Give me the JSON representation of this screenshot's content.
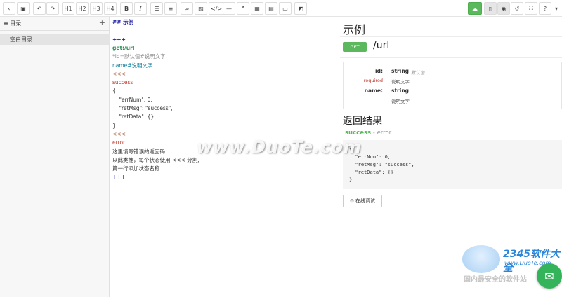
{
  "toolbar": {
    "headings": [
      "H1",
      "H2",
      "H3",
      "H4"
    ],
    "bold": "B",
    "italic": "I"
  },
  "sidebar": {
    "title": "目录",
    "add": "+",
    "empty_item": "空白目录"
  },
  "editor": {
    "lines": [
      {
        "text": "## 示例",
        "cls": "c-head"
      },
      {
        "text": "",
        "cls": "c-plain"
      },
      {
        "text": "+++",
        "cls": "c-plus"
      },
      {
        "text": "get:/url",
        "cls": "c-get"
      },
      {
        "text": "*id=默认值#说明文字",
        "cls": "c-cmt"
      },
      {
        "text": "name#说明文字",
        "cls": "c-key"
      },
      {
        "text": "<<<",
        "cls": "c-sep"
      },
      {
        "text": "success",
        "cls": "c-succ"
      },
      {
        "text": "{",
        "cls": "c-plain"
      },
      {
        "text": "    \"errNum\": 0,",
        "cls": "c-plain"
      },
      {
        "text": "    \"retMsg\": \"success\",",
        "cls": "c-plain"
      },
      {
        "text": "    \"retData\": {}",
        "cls": "c-plain"
      },
      {
        "text": "}",
        "cls": "c-plain"
      },
      {
        "text": "<<<",
        "cls": "c-sep"
      },
      {
        "text": "error",
        "cls": "c-err"
      },
      {
        "text": "这里填写错误的返回码",
        "cls": "c-plain"
      },
      {
        "text": "以此类推，每个状态使用 <<< 分割,",
        "cls": "c-plain"
      },
      {
        "text": "第一行添加状态名称",
        "cls": "c-plain"
      },
      {
        "text": "+++",
        "cls": "c-plus"
      }
    ]
  },
  "preview": {
    "title": "示例",
    "method": "GET",
    "url": "/url",
    "params": [
      {
        "name": "id:",
        "type": "string",
        "default": "默认值",
        "required": "required",
        "desc": "说明文字"
      },
      {
        "name": "name:",
        "type": "string",
        "default": "",
        "required": "",
        "desc": "说明文字"
      }
    ],
    "return_title": "返回结果",
    "tab_success": "success",
    "tab_sep": " - ",
    "tab_error": "error",
    "code_lines": [
      "{",
      "  \"errNum\": 0,",
      "  \"retMsg\": \"success\",",
      "  \"retData\": {}",
      "}"
    ],
    "test_button": "在线调试"
  },
  "watermark": {
    "duote": "www.DuoTe.com",
    "brand": "2345软件大全",
    "brand_url": "www.DuoTe.com",
    "brand_slogan": "国内最安全的软件站"
  },
  "colors": {
    "accent_green": "#5cb85c",
    "sidebar_bg": "#f7f7f7"
  }
}
